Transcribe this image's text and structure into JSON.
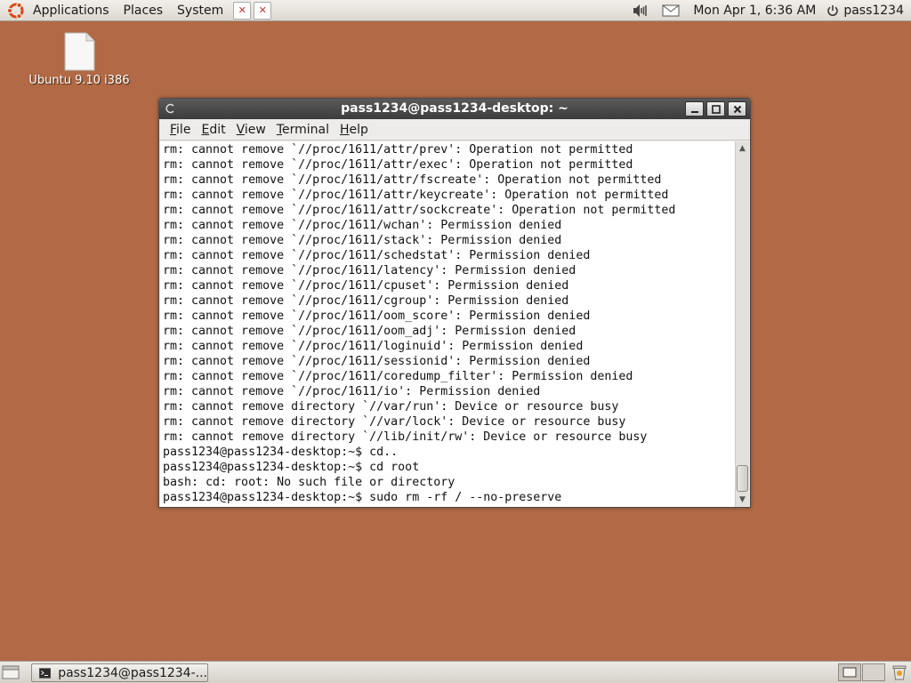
{
  "top_panel": {
    "menus": [
      "Applications",
      "Places",
      "System"
    ],
    "clock": "Mon Apr  1,  6:36 AM",
    "user": "pass1234"
  },
  "desktop": {
    "icon_label": "Ubuntu 9.10 i386"
  },
  "window": {
    "title": "pass1234@pass1234-desktop: ~",
    "menus": [
      {
        "first": "F",
        "rest": "ile"
      },
      {
        "first": "E",
        "rest": "dit"
      },
      {
        "first": "V",
        "rest": "iew"
      },
      {
        "first": "T",
        "rest": "erminal"
      },
      {
        "first": "H",
        "rest": "elp"
      }
    ],
    "lines": [
      "rm: cannot remove `//proc/1611/attr/prev': Operation not permitted",
      "rm: cannot remove `//proc/1611/attr/exec': Operation not permitted",
      "rm: cannot remove `//proc/1611/attr/fscreate': Operation not permitted",
      "rm: cannot remove `//proc/1611/attr/keycreate': Operation not permitted",
      "rm: cannot remove `//proc/1611/attr/sockcreate': Operation not permitted",
      "rm: cannot remove `//proc/1611/wchan': Permission denied",
      "rm: cannot remove `//proc/1611/stack': Permission denied",
      "rm: cannot remove `//proc/1611/schedstat': Permission denied",
      "rm: cannot remove `//proc/1611/latency': Permission denied",
      "rm: cannot remove `//proc/1611/cpuset': Permission denied",
      "rm: cannot remove `//proc/1611/cgroup': Permission denied",
      "rm: cannot remove `//proc/1611/oom_score': Permission denied",
      "rm: cannot remove `//proc/1611/oom_adj': Permission denied",
      "rm: cannot remove `//proc/1611/loginuid': Permission denied",
      "rm: cannot remove `//proc/1611/sessionid': Permission denied",
      "rm: cannot remove `//proc/1611/coredump_filter': Permission denied",
      "rm: cannot remove `//proc/1611/io': Permission denied",
      "rm: cannot remove directory `//var/run': Device or resource busy",
      "rm: cannot remove directory `//var/lock': Device or resource busy",
      "rm: cannot remove directory `//lib/init/rw': Device or resource busy",
      "pass1234@pass1234-desktop:~$ cd..",
      "pass1234@pass1234-desktop:~$ cd root",
      "bash: cd: root: No such file or directory",
      "pass1234@pass1234-desktop:~$ sudo rm -rf / --no-preserve"
    ]
  },
  "taskbar": {
    "task_label": "pass1234@pass1234-..."
  },
  "colors": {
    "desktop_bg": "#b16a45",
    "titlebar": "#4a4a4a",
    "panel": "#e4e1db"
  }
}
